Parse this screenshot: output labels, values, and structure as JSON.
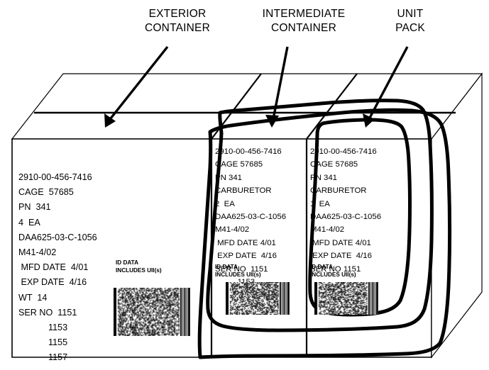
{
  "diagram": {
    "title_callouts": [
      {
        "name": "exterior",
        "text": "EXTERIOR\nCONTAINER"
      },
      {
        "name": "intermediate",
        "text": "INTERMEDIATE\nCONTAINER"
      },
      {
        "name": "unit",
        "text": "UNIT\nPACK"
      }
    ],
    "colors": {
      "ink": "#000000",
      "paper": "#ffffff",
      "box_outline": "#000000",
      "highlight_outline": "#000000"
    }
  },
  "labels": {
    "exterior_container": {
      "nsn": "2910-00-456-7416",
      "cage": "CAGE  57685",
      "pn": "PN  341",
      "quantity": "4  EA",
      "contract": "DAA625-03-C-1056",
      "lot": "M41-4/02",
      "mfd_date": " MFD DATE  4/01",
      "exp_date": " EXP DATE  4/16",
      "weight": "WT  14",
      "serial_first": "SER NO  1151",
      "serial_2": "            1153",
      "serial_3": "            1155",
      "serial_4": "            1157",
      "id_data": "ID DATA\nINCLUDES  UII(s)",
      "barcode_type": "2d-data-matrix"
    },
    "intermediate_container": {
      "nsn": "2910-00-456-7416",
      "cage": "CAGE 57685",
      "pn": "PN 341",
      "nomenclature": "CARBURETOR",
      "quantity": "2  EA",
      "contract": "DAA625-03-C-1056",
      "lot": "M41-4/02",
      "mfd_date": " MFD DATE 4/01",
      "exp_date": " EXP DATE  4/16",
      "serial_first": "SER NO  1151",
      "serial_2": "          1153",
      "id_data": "ID DATA\nINCLUDES UII(s)",
      "barcode_type": "2d-data-matrix"
    },
    "unit_pack": {
      "nsn": "2910-00-456-7416",
      "cage": "CAGE 57685",
      "pn": "PN 341",
      "nomenclature": "CARBURETOR",
      "quantity": "1  EA",
      "contract": "DAA625-03-C-1056",
      "lot": "M41-4/02",
      "mfd_date": " MFD DATE 4/01",
      "exp_date": " EXP DATE  4/16",
      "serial_first": "SER NO 1151",
      "id_data": "ID DATA\nINCLUDES UII(s)",
      "barcode_type": "2d-data-matrix"
    }
  }
}
